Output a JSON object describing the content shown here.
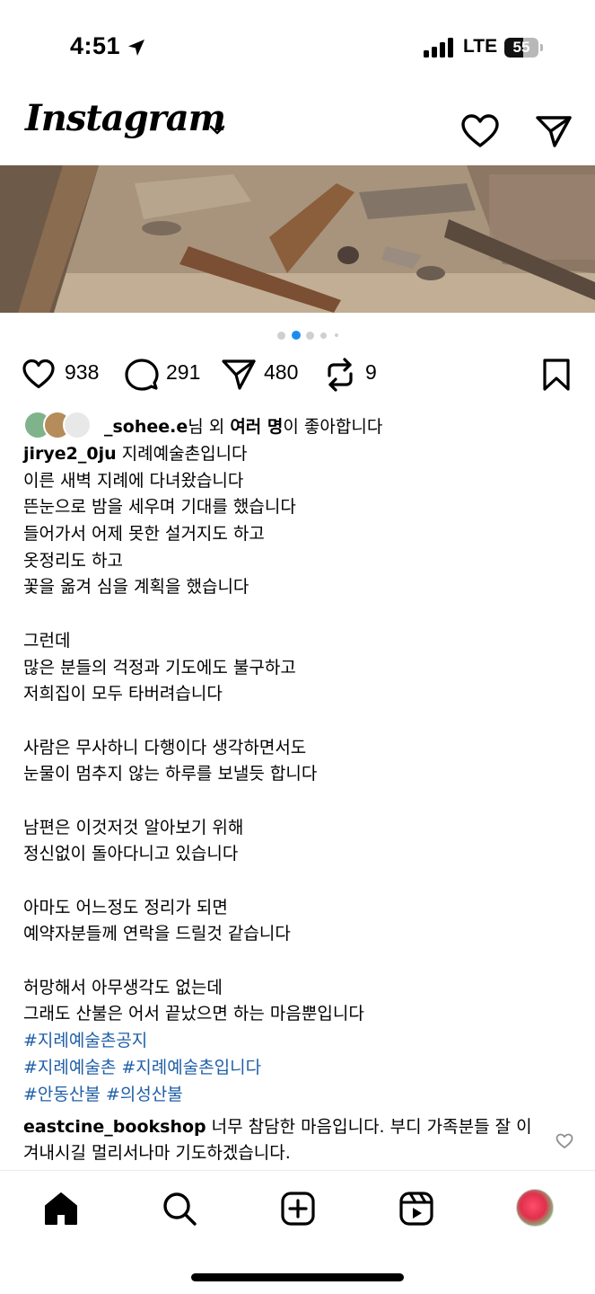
{
  "status_bar": {
    "time": "4:51",
    "network": "LTE",
    "battery_level": "55",
    "battery_fraction": 0.55,
    "icons": [
      "location-arrow-icon",
      "signal-bars-icon",
      "battery-icon"
    ]
  },
  "header": {
    "logo": "Instagram",
    "icons": [
      "chevron-down-icon",
      "heart-icon",
      "direct-message-icon"
    ]
  },
  "carousel": {
    "total": 5,
    "active_index": 1,
    "active_color": "#1a8cf0"
  },
  "actions": {
    "likes": "938",
    "comments": "291",
    "shares": "480",
    "reposts": "9",
    "icons": [
      "heart-icon",
      "comment-icon",
      "share-icon",
      "repost-icon",
      "bookmark-icon"
    ]
  },
  "likes_line": {
    "username": "_sohee.e",
    "suffix1": "님 외 ",
    "bold": "여러 명",
    "suffix2": "이 좋아합니다"
  },
  "caption": {
    "username": "jirye2_0ju",
    "first_line": " 지례예술촌입니다",
    "lines": [
      "이른 새벽 지례에 다녀왔습니다",
      "뜬눈으로 밤을 세우며 기대를 했습니다",
      "들어가서 어제 못한 설거지도 하고",
      "옷정리도 하고",
      "꽃을 옮겨 심을 계획을 했습니다",
      "",
      "그런데",
      "많은 분들의 걱정과 기도에도 불구하고",
      "저희집이 모두 타버려습니다",
      "",
      "사람은 무사하니 다행이다 생각하면서도",
      "눈물이 멈추지 않는 하루를 보낼듯 합니다",
      "",
      "남편은 이것저것 알아보기 위해",
      "정신없이 돌아다니고 있습니다",
      "",
      "아마도 어느정도 정리가 되면",
      "예약자분들께 연락을 드릴것 같습니다",
      "",
      "허망해서 아무생각도 없는데",
      "그래도 산불은 어서 끝났으면 하는 마음뿐입니다"
    ],
    "hashtags": [
      "#지례예술촌공지",
      "#지례예술촌 #지례예술촌입니다",
      "#안동산불 #의성산불"
    ],
    "hashtag_color": "#1f5fa8"
  },
  "comment": {
    "username": "eastcine_bookshop",
    "text": " 너무 참담한 마음입니다. 부디 가족분들 잘 이겨내시길 멀리서나마 기도하겠습니다."
  },
  "bottom_nav": {
    "items": [
      "home-icon",
      "search-icon",
      "create-icon",
      "reels-icon",
      "profile-avatar"
    ]
  }
}
